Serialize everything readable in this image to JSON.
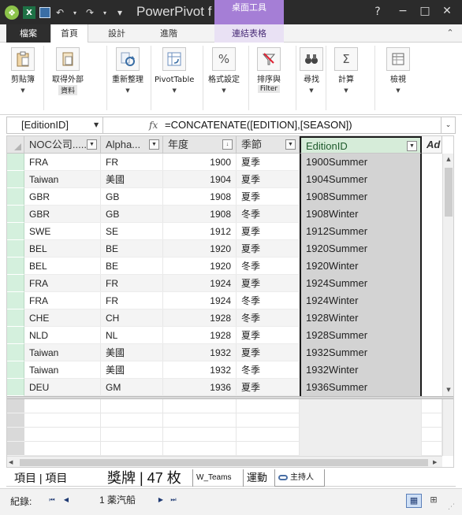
{
  "window": {
    "title": "PowerPivot f",
    "context_group": "桌面工具",
    "help": "?",
    "minimize": "−",
    "maximize": "□",
    "close": "✕"
  },
  "quick_access": {
    "app_glyph": "❖",
    "excel_glyph": "X",
    "undo": "↶",
    "redo": "↷",
    "more": "▾"
  },
  "tabs": [
    {
      "label": "檔案"
    },
    {
      "label": "首頁"
    },
    {
      "label": "設計"
    },
    {
      "label": "進階"
    },
    {
      "label": "連結表格"
    }
  ],
  "ribbon": {
    "clipboard": {
      "label": "剪貼簿",
      "icon": "clipboard-icon"
    },
    "get_external": {
      "label": "取得外部",
      "sublabel": "資料",
      "icon": "database-icon"
    },
    "refresh": {
      "label": "重新整理",
      "icon": "refresh-icon"
    },
    "pivottable": {
      "label": "PivotTable",
      "icon": "pivot-icon"
    },
    "format": {
      "label": "格式設定",
      "icon": "percent-icon",
      "glyph": "%"
    },
    "sort_filter": {
      "label": "排序與",
      "sublabel": "Filter",
      "icon": "filter-icon"
    },
    "find": {
      "label": "尋找",
      "icon": "binoculars-icon"
    },
    "calculate": {
      "label": "計算",
      "icon": "sigma-icon",
      "glyph": "Σ"
    },
    "view": {
      "label": "檢視",
      "icon": "view-icon"
    }
  },
  "formula_bar": {
    "name_box": "[EditionID]",
    "fx": "fx",
    "formula": "=CONCATENATE([EDITION],[SEASON])"
  },
  "table": {
    "columns": [
      "NOC公司......",
      "Alpha...",
      "年度",
      "季節",
      "EditionID",
      "Ad"
    ],
    "rows": [
      [
        "FRA",
        "FR",
        "1900",
        "夏季",
        "1900Summer"
      ],
      [
        "Taiwan",
        "美國",
        "1904",
        "夏季",
        "1904Summer"
      ],
      [
        "GBR",
        "GB",
        "1908",
        "夏季",
        "1908Summer"
      ],
      [
        "GBR",
        "GB",
        "1908",
        "冬季",
        "1908Winter"
      ],
      [
        "SWE",
        "SE",
        "1912",
        "夏季",
        "1912Summer"
      ],
      [
        "BEL",
        "BE",
        "1920",
        "夏季",
        "1920Summer"
      ],
      [
        "BEL",
        "BE",
        "1920",
        "冬季",
        "1920Winter"
      ],
      [
        "FRA",
        "FR",
        "1924",
        "夏季",
        "1924Summer"
      ],
      [
        "FRA",
        "FR",
        "1924",
        "冬季",
        "1924Winter"
      ],
      [
        "CHE",
        "CH",
        "1928",
        "冬季",
        "1928Winter"
      ],
      [
        "NLD",
        "NL",
        "1928",
        "夏季",
        "1928Summer"
      ],
      [
        "Taiwan",
        "美國",
        "1932",
        "夏季",
        "1932Summer"
      ],
      [
        "Taiwan",
        "美國",
        "1932",
        "冬季",
        "1932Winter"
      ],
      [
        "DEU",
        "GM",
        "1936",
        "夏季",
        "1936Summer"
      ]
    ]
  },
  "sheet_tabs": [
    {
      "label": "項目 | 項目"
    },
    {
      "label": "獎牌 | 47 枚"
    },
    {
      "label": "W_Teams"
    },
    {
      "label": "運動"
    },
    {
      "label": "主持人"
    }
  ],
  "status": {
    "record_label": "紀錄:",
    "record_value": "1 薬汽船",
    "first": "⏮",
    "prev": "◀",
    "next": "▶",
    "last": "⏭"
  },
  "colors": {
    "accent_context": "#a57ed6",
    "selected_header": "#d6ecd9",
    "row_selector": "#d4f0dd",
    "titlebar": "#2b2b2b"
  }
}
